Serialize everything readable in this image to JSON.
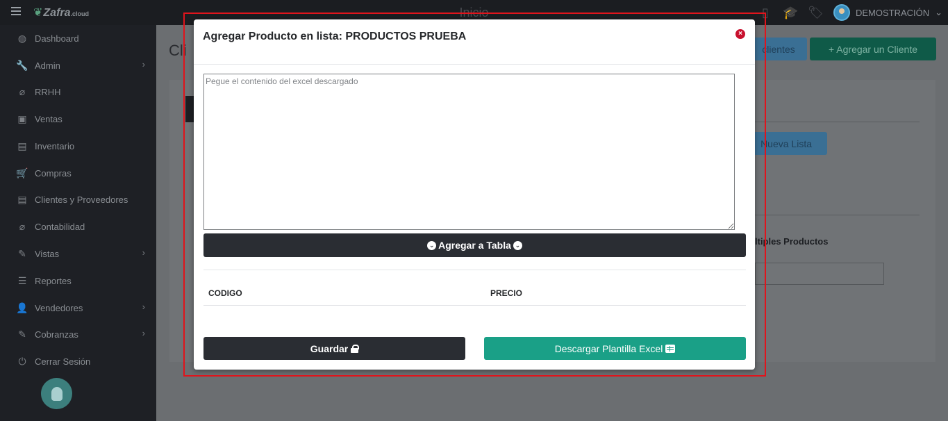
{
  "app": {
    "brand": "Zafra",
    "brand_suffix": ".cloud",
    "title": "Inicio"
  },
  "top_icons": [
    "mobile-icon",
    "graduation-cap-icon",
    "tags-icon"
  ],
  "user": {
    "name": "DEMOSTRACIÓN"
  },
  "sidebar": {
    "items": [
      {
        "label": "Dashboard",
        "icon": "palette-icon",
        "submenu": false
      },
      {
        "label": "Admin",
        "icon": "wrench-icon",
        "submenu": true
      },
      {
        "label": "RRHH",
        "icon": "paperclip-icon",
        "submenu": false
      },
      {
        "label": "Ventas",
        "icon": "money-icon",
        "submenu": false
      },
      {
        "label": "Inventario",
        "icon": "book-icon",
        "submenu": false
      },
      {
        "label": "Compras",
        "icon": "cart-icon",
        "submenu": false
      },
      {
        "label": "Clientes y Proveedores",
        "icon": "book-icon",
        "submenu": false
      },
      {
        "label": "Contabilidad",
        "icon": "paperclip-icon",
        "submenu": false
      },
      {
        "label": "Vistas",
        "icon": "edit-icon",
        "submenu": true
      },
      {
        "label": "Reportes",
        "icon": "list-icon",
        "submenu": false
      },
      {
        "label": "Vendedores",
        "icon": "user-icon",
        "submenu": true
      },
      {
        "label": "Cobranzas",
        "icon": "edit-icon",
        "submenu": true
      },
      {
        "label": "Cerrar Sesión",
        "icon": "power-icon",
        "submenu": false
      }
    ]
  },
  "background": {
    "page_title": "Cli",
    "clients_button": "clientes",
    "add_client_button": "+  Agregar un Cliente",
    "new_list_button": "Nueva Lista",
    "multi_products_label": "ltiples Productos"
  },
  "modal": {
    "title": "Agregar Producto en lista: PRODUCTOS PRUEBA",
    "close_symbol": "×",
    "textarea_placeholder": "Pegue el contenido del excel descargado",
    "add_to_table_button": "Agregar a Tabla",
    "table_headers": [
      "CODIGO",
      "PRECIO"
    ],
    "save_button": "Guardar",
    "download_button": "Descargar Plantilla Excel"
  },
  "colors": {
    "modal_accent_green": "#1aa087",
    "dark_button": "#2a2d33",
    "close_red": "#c8102e",
    "highlight_red": "#e0141c"
  }
}
